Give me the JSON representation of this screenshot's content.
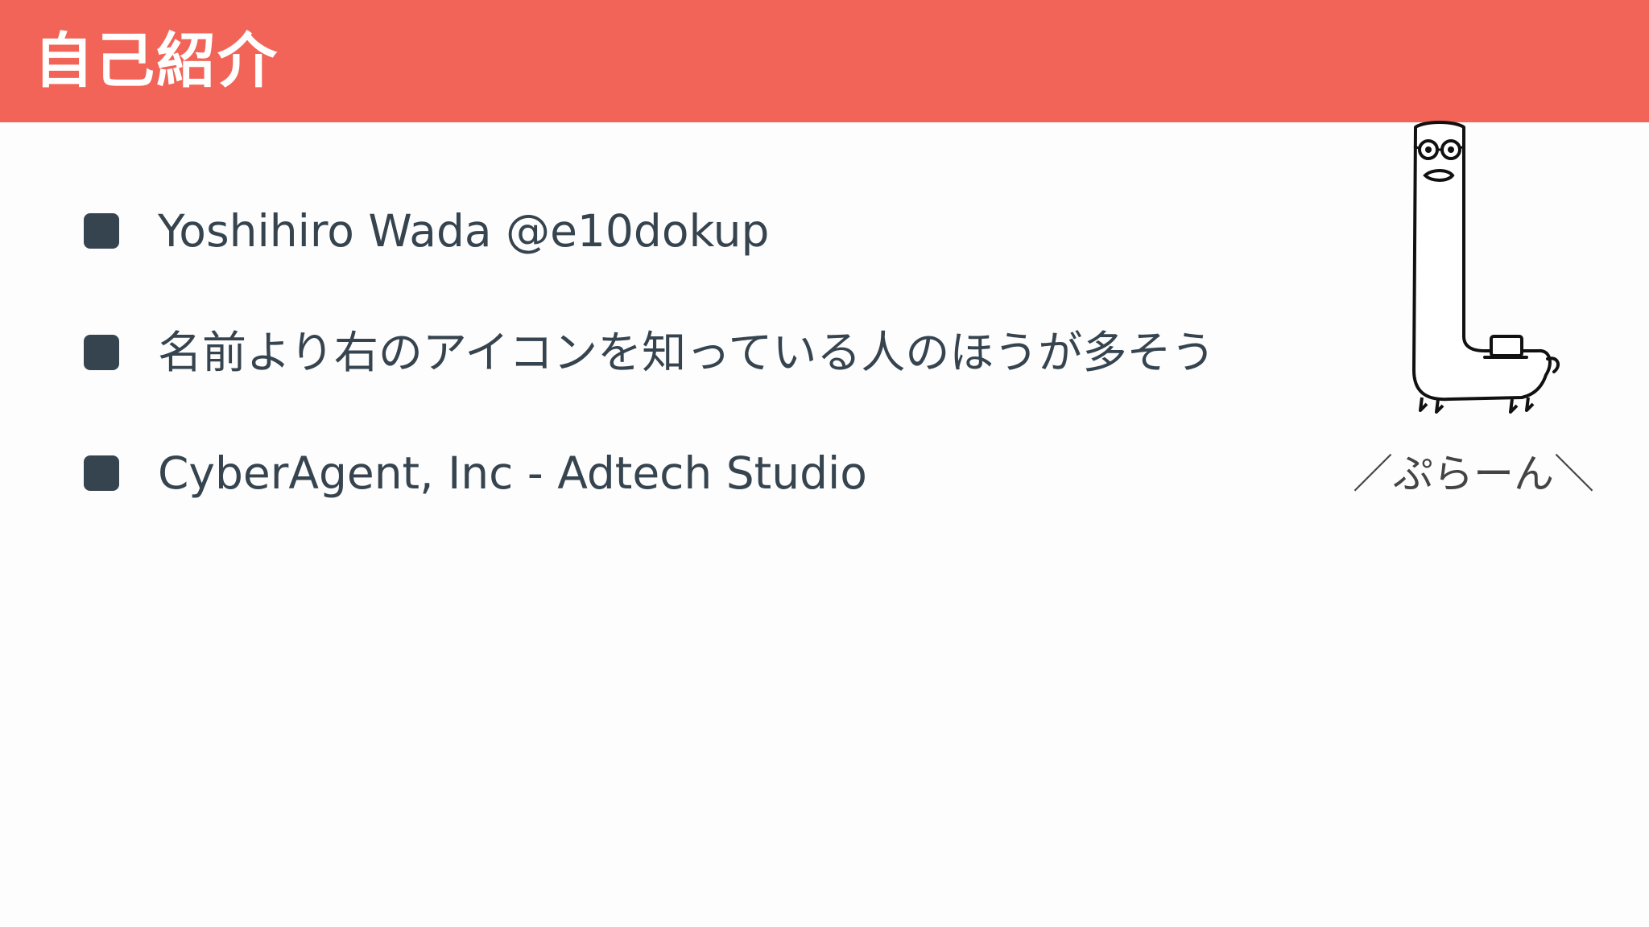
{
  "slide": {
    "title": "自己紹介",
    "bullets": [
      {
        "text": "Yoshihiro Wada @e10dokup"
      },
      {
        "text": "名前より右のアイコンを知っている人のほうが多そう"
      },
      {
        "text": "CyberAgent, Inc - Adtech Studio"
      }
    ],
    "icon": {
      "name": "l-shaped-character-icon",
      "caption": "／ぷらーん＼"
    }
  },
  "colors": {
    "title_bar": "#f26457",
    "title_text": "#ffffff",
    "bullet_marker": "#36444f",
    "body_text": "#36444f",
    "background": "#fdfdfd"
  }
}
